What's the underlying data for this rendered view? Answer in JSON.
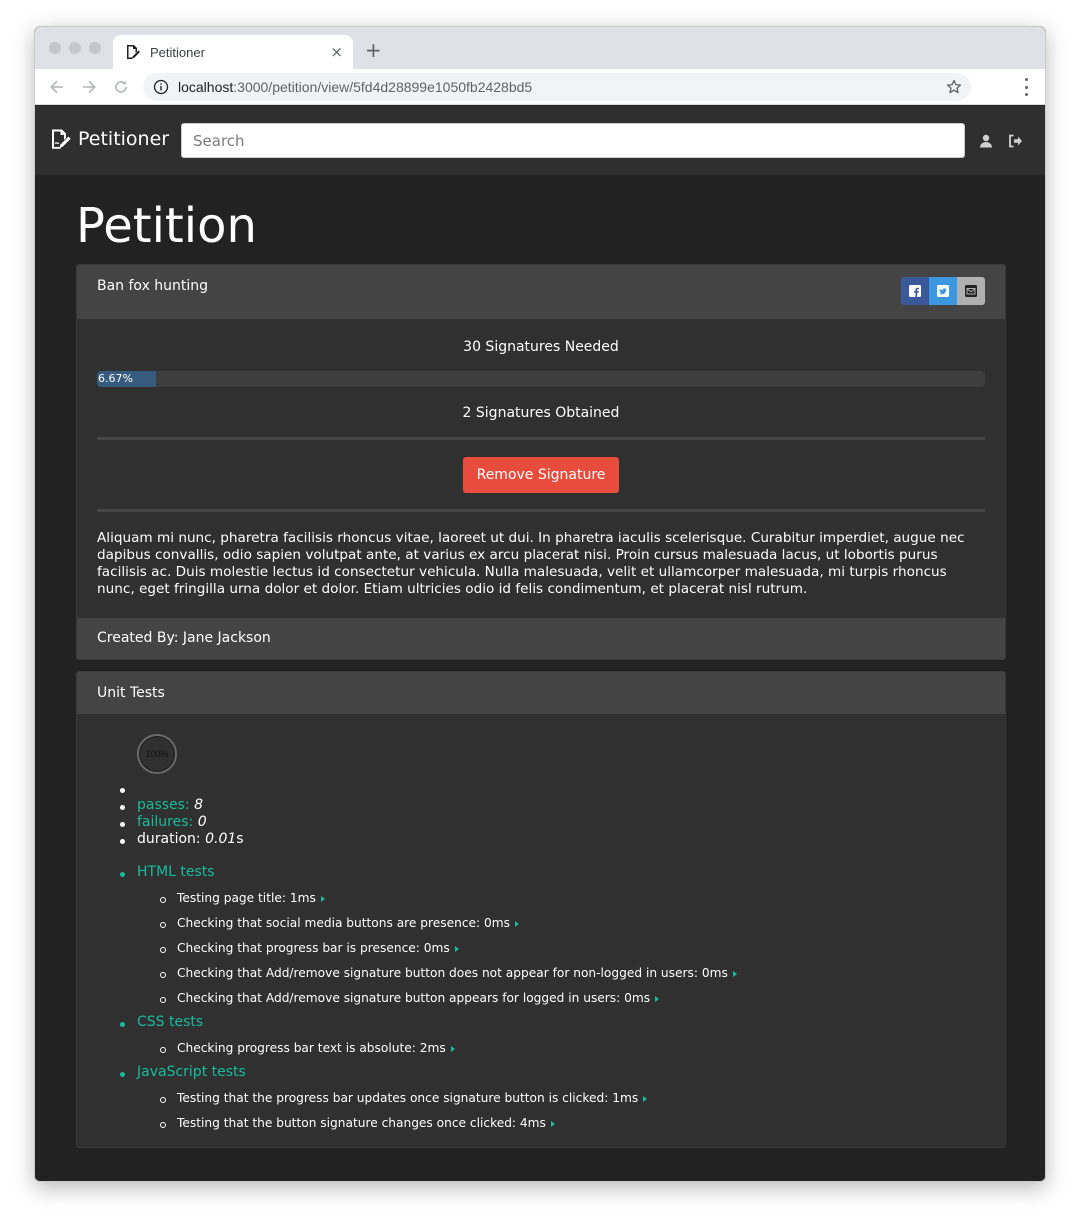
{
  "browser": {
    "tab_title": "Petitioner",
    "close_glyph": "×",
    "new_tab_glyph": "+",
    "url_host": "localhost",
    "url_path": ":3000/petition/view/5fd4d28899e1050fb2428bd5"
  },
  "navbar": {
    "brand": "Petitioner",
    "search_placeholder": "Search"
  },
  "page": {
    "title": "Petition"
  },
  "petition": {
    "name": "Ban fox hunting",
    "needed": "30 Signatures Needed",
    "progress_label": "6.67%",
    "progress_percent": 6.67,
    "obtained": "2 Signatures Obtained",
    "remove_button": "Remove Signature",
    "description": "Aliquam mi nunc, pharetra facilisis rhoncus vitae, laoreet ut dui. In pharetra iaculis scelerisque. Curabitur imperdiet, augue nec dapibus convallis, odio sapien volutpat ante, at varius ex arcu placerat nisi. Proin cursus malesuada lacus, ut lobortis purus facilisis ac. Duis molestie lectus id consectetur vehicula. Nulla malesuada, velit et ullamcorper malesuada, mi turpis rhoncus nunc, eget fringilla urna dolor et dolor. Etiam ultricies odio id felis condimentum, et placerat nisl rutrum.",
    "created_by": "Created By: Jane Jackson"
  },
  "tests": {
    "title": "Unit Tests",
    "progress_ring": "100%",
    "passes_label": "passes:",
    "passes_value": "8",
    "failures_label": "failures:",
    "failures_value": "0",
    "duration_label": "duration:",
    "duration_value": "0.01",
    "duration_unit": "s",
    "suites": [
      {
        "name": "HTML tests",
        "tests": [
          "Testing page title: 1ms",
          "Checking that social media buttons are presence: 0ms",
          "Checking that progress bar is presence: 0ms",
          "Checking that Add/remove signature button does not appear for non-logged in users: 0ms",
          "Checking that Add/remove signature button appears for logged in users: 0ms"
        ]
      },
      {
        "name": "CSS tests",
        "tests": [
          "Checking progress bar text is absolute: 2ms"
        ]
      },
      {
        "name": "JavaScript tests",
        "tests": [
          "Testing that the progress bar updates once signature button is clicked: 1ms",
          "Testing that the button signature changes once clicked: 4ms"
        ]
      }
    ]
  },
  "colors": {
    "danger": "#e74c3c",
    "success": "#18bc9c",
    "primary": "#375a7f"
  }
}
